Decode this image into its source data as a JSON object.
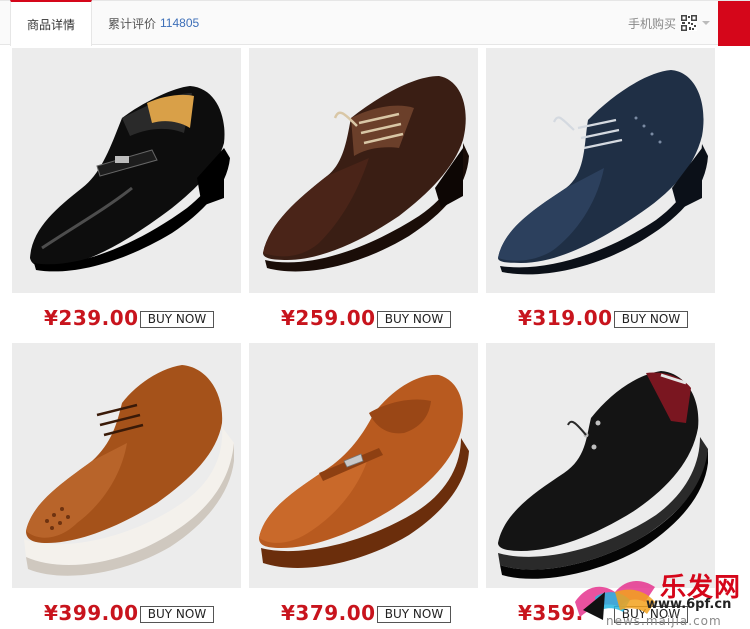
{
  "tabs": {
    "details_label": "商品详情",
    "reviews_label": "累计评价",
    "reviews_count": "114805",
    "mobile_buy_label": "手机购买"
  },
  "accent_color": "#d5061a",
  "price_color": "#c8141d",
  "products": [
    {
      "price": "¥239.00",
      "button": "BUY NOW",
      "color": "black patent"
    },
    {
      "price": "¥259.00",
      "button": "BUY NOW",
      "color": "brown patent"
    },
    {
      "price": "¥319.00",
      "button": "BUY NOW",
      "color": "navy"
    },
    {
      "price": "¥399.00",
      "button": "BUY NOW",
      "color": "tan brogue"
    },
    {
      "price": "¥379.00",
      "button": "BUY NOW",
      "color": "orange loafer"
    },
    {
      "price": "¥359.",
      "button": "BUY NOW",
      "color": "black casual"
    }
  ],
  "watermark": {
    "logo_text": "乐发网",
    "url_primary": "www.6pf.cn",
    "url_secondary": "news.maijia.com"
  }
}
